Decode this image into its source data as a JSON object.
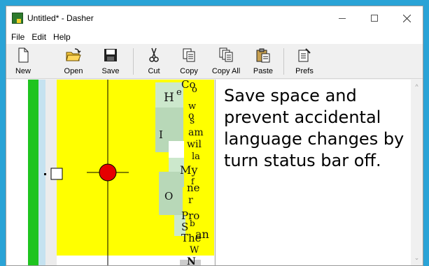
{
  "window": {
    "title": "Untitled* - Dasher",
    "controls": {
      "minimize": "minimize-icon",
      "maximize": "maximize-icon",
      "close": "close-icon"
    }
  },
  "menu": [
    "File",
    "Edit",
    "Help"
  ],
  "toolbar": {
    "new": "New",
    "open": "Open",
    "save": "Save",
    "cut": "Cut",
    "copy": "Copy",
    "copy_all": "Copy All",
    "paste": "Paste",
    "prefs": "Prefs"
  },
  "text_panel": {
    "content": "Save space and prevent accidental language changes by turn status bar off."
  },
  "dasher_letters": [
    "H",
    "e",
    "Co",
    "w",
    "o",
    "o",
    "s",
    "am",
    "I",
    "wil",
    "la",
    "My",
    "f",
    "ne",
    "O",
    "r",
    "Pro",
    "S",
    "b",
    "The",
    "an",
    "W",
    "N"
  ],
  "colors": {
    "accent_green": "#1fc41f",
    "canvas_yellow": "#ffff00",
    "cursor_red": "#e60000",
    "light_blue": "#c5e2f0",
    "letter_green": "#b8d8b8"
  }
}
